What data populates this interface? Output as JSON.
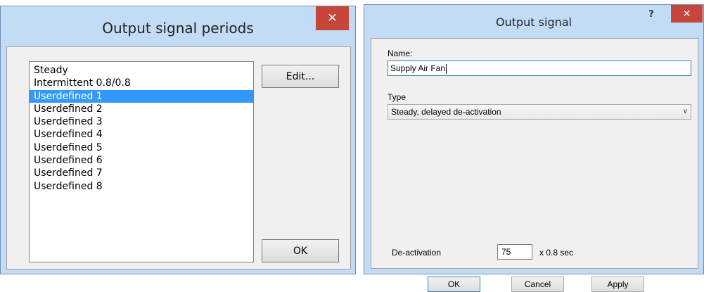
{
  "periods_dialog": {
    "title": "Output signal periods",
    "close_glyph": "✕",
    "items": [
      "Steady",
      "Intermittent 0.8/0.8",
      "Userdefined 1",
      "Userdefined 2",
      "Userdefined 3",
      "Userdefined 4",
      "Userdefined 5",
      "Userdefined 6",
      "Userdefined 7",
      "Userdefined 8"
    ],
    "selected_index": 2,
    "edit_label": "Edit...",
    "ok_label": "OK"
  },
  "signal_dialog": {
    "title": "Output signal",
    "help_glyph": "?",
    "close_glyph": "✕",
    "name_label": "Name:",
    "name_value": "Supply Air Fan",
    "type_label": "Type",
    "type_value": "Steady, delayed de-activation",
    "type_chevron": "∨",
    "deactivation_label": "De-activation",
    "deactivation_value": "75",
    "deactivation_unit": "x 0.8 sec",
    "ok_label": "OK",
    "cancel_label": "Cancel",
    "apply_label": "Apply"
  },
  "colors": {
    "frame": "#c3dcf5",
    "close_button": "#c7463a",
    "selection": "#3399ff"
  }
}
